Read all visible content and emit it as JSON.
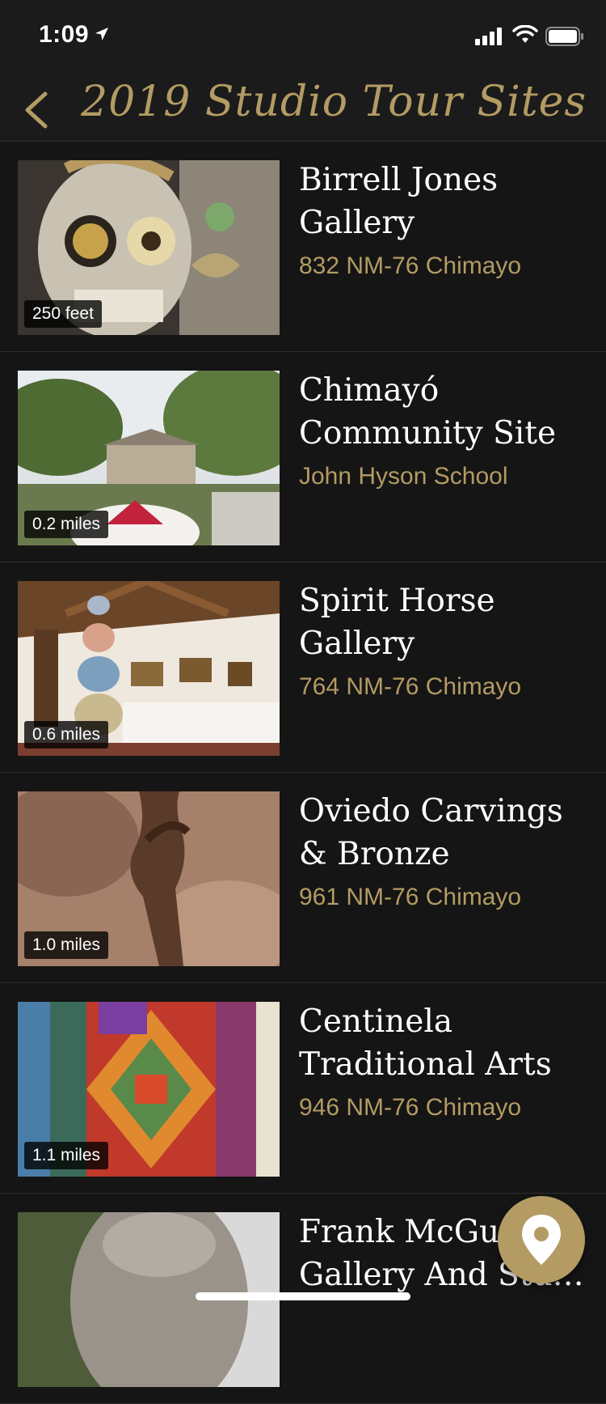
{
  "status": {
    "time": "1:09"
  },
  "nav": {
    "title": "2019 Studio Tour Sites"
  },
  "sites": [
    {
      "lines": [
        "Birrell Jones",
        "Gallery"
      ],
      "address": "832 NM-76 Chimayo",
      "distance": "250 feet",
      "image": "skull-mural-image"
    },
    {
      "lines": [
        "Chimayó",
        "Community Site"
      ],
      "address": "John Hyson School",
      "distance": "0.2 miles",
      "image": "school-building-image"
    },
    {
      "lines": [
        "Spirit Horse",
        "Gallery"
      ],
      "address": "764 NM-76 Chimayo",
      "distance": "0.6 miles",
      "image": "gallery-interior-image"
    },
    {
      "lines": [
        "Oviedo Carvings",
        "& Bronze"
      ],
      "address": "961 NM-76 Chimayo",
      "distance": "1.0 miles",
      "image": "bronze-sculpture-image"
    },
    {
      "lines": [
        "Centinela",
        "Traditional Arts"
      ],
      "address": "946 NM-76 Chimayo",
      "distance": "1.1 miles",
      "image": "woven-textile-image"
    },
    {
      "lines": [
        "Frank McGuire",
        "Gallery And Studio"
      ],
      "address": "",
      "distance": "",
      "image": "stone-bust-image"
    }
  ],
  "colors": {
    "accent": "#b39b63",
    "background": "#1b1b1b"
  },
  "icons": {
    "back": "chevron-left-icon",
    "map": "map-pin-icon"
  }
}
